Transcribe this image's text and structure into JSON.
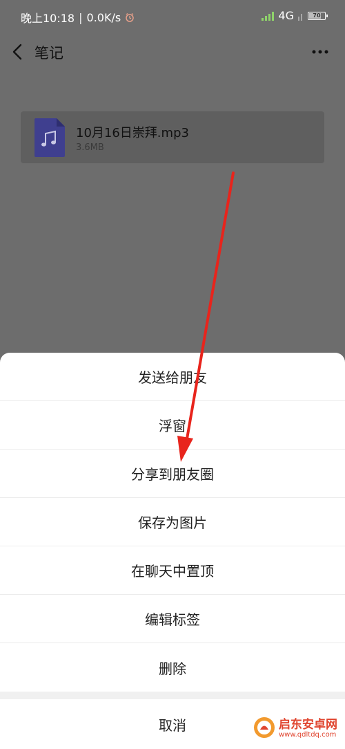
{
  "status_bar": {
    "time": "晚上10:18",
    "separator": "|",
    "speed": "0.0K/s",
    "network": "4G",
    "battery": "70"
  },
  "header": {
    "title": "笔记"
  },
  "file": {
    "name": "10月16日崇拜.mp3",
    "size": "3.6MB"
  },
  "action_sheet": {
    "items": [
      {
        "label": "发送给朋友"
      },
      {
        "label": "浮窗"
      },
      {
        "label": "分享到朋友圈"
      },
      {
        "label": "保存为图片"
      },
      {
        "label": "在聊天中置顶"
      },
      {
        "label": "编辑标签"
      },
      {
        "label": "删除"
      }
    ],
    "cancel": "取消"
  },
  "watermark": {
    "title": "启东安卓网",
    "url": "www.qdltdq.com"
  },
  "colors": {
    "overlay_bg": "#6d6d6d",
    "file_icon": "#3f3f8f",
    "arrow": "#e8241c",
    "signal": "#8fd36a",
    "watermark": "#e0452f"
  }
}
